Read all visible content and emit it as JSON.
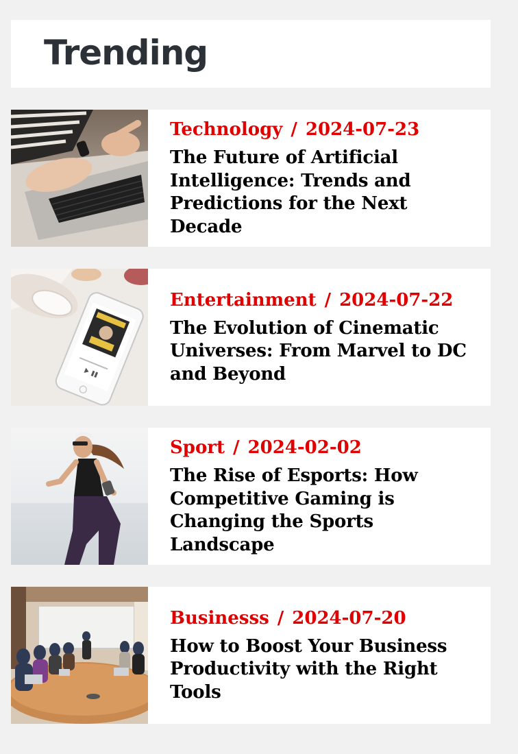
{
  "section": {
    "title": "Trending"
  },
  "articles": [
    {
      "category": "Technology",
      "separator": "/",
      "date": "2024-07-23",
      "title": "The Future of Artificial Intelligence: Trends and Predictions for the Next Decade",
      "image_icon": "laptop-typing-image"
    },
    {
      "category": "Entertainment",
      "separator": "/",
      "date": "2024-07-22",
      "title": "The Evolution of Cinematic Universes: From Marvel to DC and Beyond",
      "image_icon": "phone-audiobook-image"
    },
    {
      "category": "Sport",
      "separator": "/",
      "date": "2024-02-02",
      "title": "The Rise of Esports: How Competitive Gaming is Changing the Sports Landscape",
      "image_icon": "runner-image"
    },
    {
      "category": "Businesss",
      "separator": "/",
      "date": "2024-07-20",
      "title": "How to Boost Your Business Productivity with the Right Tools",
      "image_icon": "meeting-room-image"
    }
  ],
  "colors": {
    "page_background": "#f1f1f1",
    "card_background": "#ffffff",
    "category_red": "#e10000",
    "heading_dark": "#2c3138",
    "headline_black": "#000000"
  }
}
